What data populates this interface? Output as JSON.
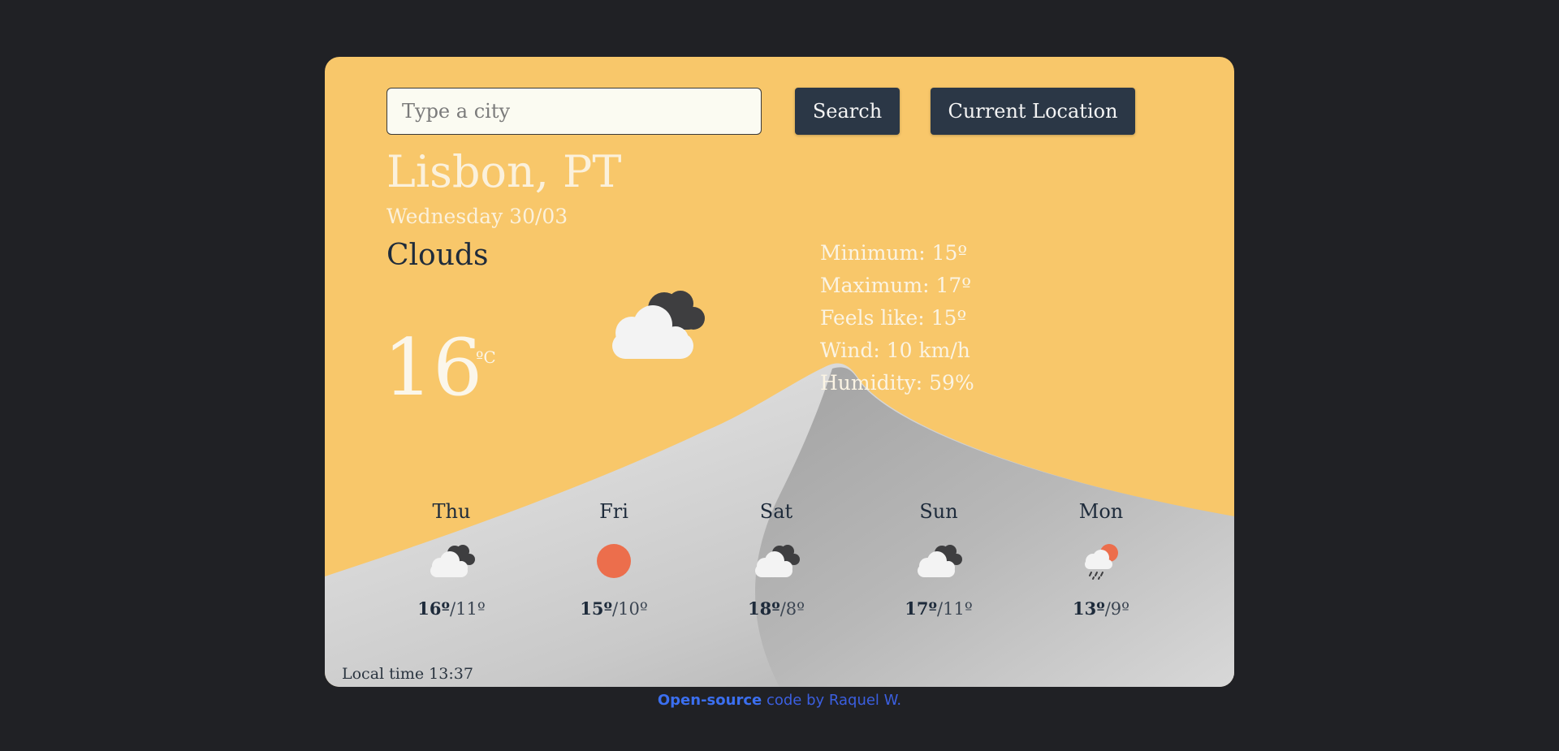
{
  "search": {
    "placeholder": "Type a city",
    "value": "",
    "search_label": "Search",
    "location_label": "Current Location"
  },
  "current": {
    "city": "Lisbon, PT",
    "date": "Wednesday 30/03",
    "condition": "Clouds",
    "temperature": "16",
    "unit": "ºC",
    "icon": "broken-clouds-icon"
  },
  "details": {
    "minimum": "Minimum: 15º",
    "maximum": "Maximum: 17º",
    "feels_like": "Feels like: 15º",
    "wind": "Wind: 10 km/h",
    "humidity": "Humidity: 59%"
  },
  "forecast": [
    {
      "day": "Thu",
      "max": "16º",
      "min": "/11º",
      "icon": "broken-clouds-icon"
    },
    {
      "day": "Fri",
      "max": "15º",
      "min": "/10º",
      "icon": "clear-sun-icon"
    },
    {
      "day": "Sat",
      "max": "18º",
      "min": "/8º",
      "icon": "broken-clouds-icon"
    },
    {
      "day": "Sun",
      "max": "17º",
      "min": "/11º",
      "icon": "broken-clouds-icon"
    },
    {
      "day": "Mon",
      "max": "13º",
      "min": "/9º",
      "icon": "rain-sun-icon"
    }
  ],
  "local_time": "Local time 13:37",
  "footer": {
    "link_text": "Open-source",
    "rest_text": " code by Raquel W."
  },
  "colors": {
    "card_background": "#f8c76a",
    "page_background": "#202125",
    "button_background": "#2b3746",
    "text_dark": "#1e2b3b",
    "text_light": "#fbf1dc",
    "link": "#3b6ff0"
  }
}
